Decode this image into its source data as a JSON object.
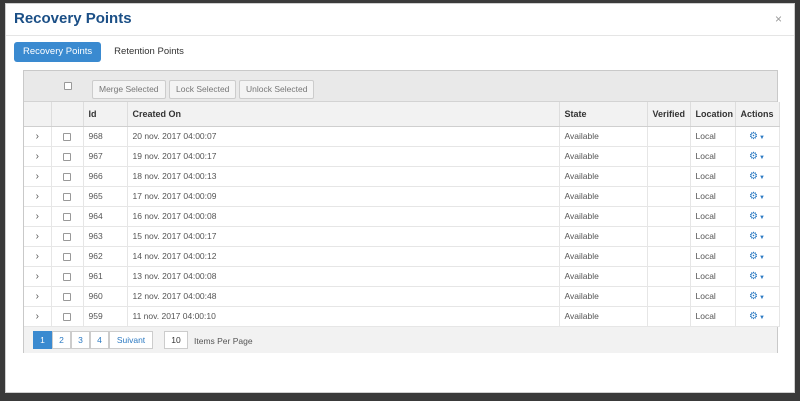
{
  "modal": {
    "title": "Recovery Points",
    "close_label": "×"
  },
  "tabs": [
    {
      "label": "Recovery Points",
      "active": true
    },
    {
      "label": "Retention Points",
      "active": false
    }
  ],
  "toolbar": {
    "merge_label": "Merge Selected",
    "lock_label": "Lock Selected",
    "unlock_label": "Unlock Selected"
  },
  "columns": {
    "id": "Id",
    "created_on": "Created On",
    "state": "State",
    "verified": "Verified",
    "location": "Location",
    "actions": "Actions"
  },
  "rows": [
    {
      "id": "968",
      "created_on": "20 nov. 2017 04:00:07",
      "state": "Available",
      "verified": "",
      "location": "Local"
    },
    {
      "id": "967",
      "created_on": "19 nov. 2017 04:00:17",
      "state": "Available",
      "verified": "",
      "location": "Local"
    },
    {
      "id": "966",
      "created_on": "18 nov. 2017 04:00:13",
      "state": "Available",
      "verified": "",
      "location": "Local"
    },
    {
      "id": "965",
      "created_on": "17 nov. 2017 04:00:09",
      "state": "Available",
      "verified": "",
      "location": "Local"
    },
    {
      "id": "964",
      "created_on": "16 nov. 2017 04:00:08",
      "state": "Available",
      "verified": "",
      "location": "Local"
    },
    {
      "id": "963",
      "created_on": "15 nov. 2017 04:00:17",
      "state": "Available",
      "verified": "",
      "location": "Local"
    },
    {
      "id": "962",
      "created_on": "14 nov. 2017 04:00:12",
      "state": "Available",
      "verified": "",
      "location": "Local"
    },
    {
      "id": "961",
      "created_on": "13 nov. 2017 04:00:08",
      "state": "Available",
      "verified": "",
      "location": "Local"
    },
    {
      "id": "960",
      "created_on": "12 nov. 2017 04:00:48",
      "state": "Available",
      "verified": "",
      "location": "Local"
    },
    {
      "id": "959",
      "created_on": "11 nov. 2017 04:00:10",
      "state": "Available",
      "verified": "",
      "location": "Local"
    }
  ],
  "pagination": {
    "pages": [
      "1",
      "2",
      "3",
      "4"
    ],
    "current": "1",
    "next_label": "Suivant",
    "page_size": "10",
    "page_size_label": "Items Per Page"
  },
  "colors": {
    "accent": "#3a8ad0",
    "title": "#1b4f86",
    "link": "#2b79c2"
  },
  "icons": {
    "expand": "chevron-right-icon",
    "actions": "gear-icon",
    "close": "close-icon"
  }
}
